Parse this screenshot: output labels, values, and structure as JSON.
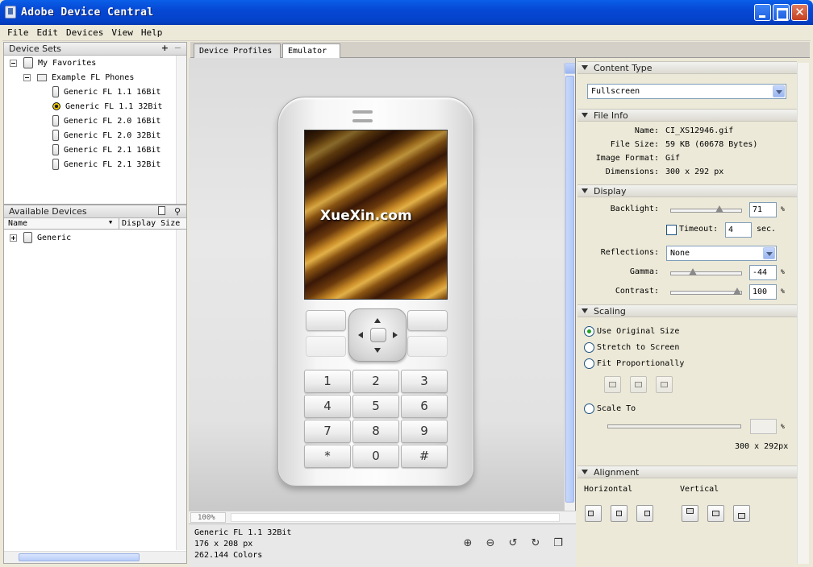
{
  "window": {
    "title": "Adobe Device Central"
  },
  "menu": [
    "File",
    "Edit",
    "Devices",
    "View",
    "Help"
  ],
  "device_sets": {
    "header": "Device Sets",
    "add": "+",
    "remove": "−",
    "root": "My Favorites",
    "folder": "Example FL Phones",
    "items": [
      "Generic FL 1.1 16Bit",
      "Generic FL 1.1 32Bit",
      "Generic FL 2.0 16Bit",
      "Generic FL 2.0 32Bit",
      "Generic FL 2.1 16Bit",
      "Generic FL 2.1 32Bit"
    ]
  },
  "available_devices": {
    "header": "Available Devices",
    "col_name": "Name",
    "col_size": "Display Size",
    "items": [
      "Generic"
    ]
  },
  "tabs": [
    "Device Profiles",
    "Emulator"
  ],
  "emulator": {
    "watermark": "XueXin.com",
    "keys": [
      "1",
      "2",
      "3",
      "4",
      "5",
      "6",
      "7",
      "8",
      "9",
      "*",
      "0",
      "#"
    ],
    "zoom": "100%"
  },
  "status": {
    "device": "Generic FL 1.1 32Bit",
    "size": "176 x 208 px",
    "colors": "262.144 Colors"
  },
  "content_type": {
    "header": "Content Type",
    "value": "Fullscreen"
  },
  "file_info": {
    "header": "File Info",
    "rows": [
      {
        "label": "Name:",
        "value": "CI_XS12946.gif"
      },
      {
        "label": "File Size:",
        "value": "59 KB (60678 Bytes)"
      },
      {
        "label": "Image Format:",
        "value": "Gif"
      },
      {
        "label": "Dimensions:",
        "value": "300 x 292 px"
      }
    ]
  },
  "display": {
    "header": "Display",
    "backlight_label": "Backlight:",
    "backlight": "71",
    "backlight_level": 0.71,
    "pct": "%",
    "timeout_label": "Timeout:",
    "timeout": "4",
    "timeout_unit": "sec.",
    "reflections_label": "Reflections:",
    "reflections": "None",
    "gamma_label": "Gamma:",
    "gamma": "-44",
    "gamma_level": 0.28,
    "contrast_label": "Contrast:",
    "contrast": "100",
    "contrast_level": 1.0
  },
  "scaling": {
    "header": "Scaling",
    "options": [
      "Use Original Size",
      "Stretch to Screen",
      "Fit Proportionally",
      "Scale To"
    ],
    "selected": "Use Original Size",
    "pct": "%",
    "size": "300 x 292px"
  },
  "alignment": {
    "header": "Alignment",
    "horizontal": "Horizontal",
    "vertical": "Vertical"
  }
}
